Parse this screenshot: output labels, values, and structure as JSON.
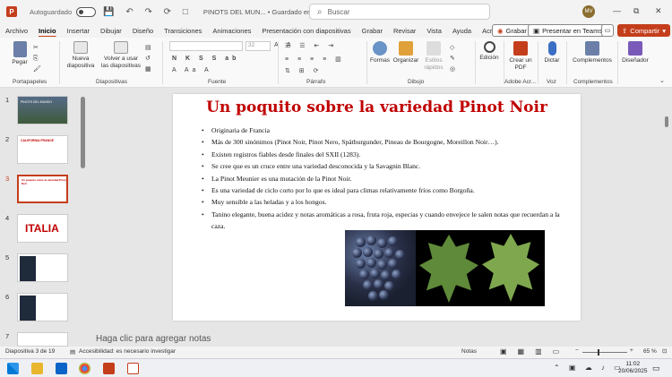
{
  "titlebar": {
    "app_logo": "P",
    "autosave_label": "Autoguardado",
    "quick_access": "💾 ↶ ↷ ⟳ □",
    "document_title": "PINOTS DEL MUN... • Guardado en Este PC ∨",
    "search_placeholder": "Buscar",
    "user_initials": "MV"
  },
  "menu": {
    "tabs": [
      "Archivo",
      "Inicio",
      "Insertar",
      "Dibujar",
      "Diseño",
      "Transiciones",
      "Animaciones",
      "Presentación con diapositivas",
      "Grabar",
      "Revisar",
      "Vista",
      "Ayuda",
      "Acrobat"
    ],
    "active_tab": "Inicio",
    "grabar_btn": "Grabar",
    "present_teams_btn": "Presentar en Teams",
    "share_btn": "Compartir"
  },
  "ribbon": {
    "paste": "Pegar",
    "new_slide": "Nueva diapositiva",
    "reuse_slides": "Volver a usar las diapositivas",
    "font_size": "32",
    "shapes": "Formas",
    "arrange": "Organizar",
    "quick_styles": "Estilos rápidos",
    "editing": "Edición",
    "create_pdf": "Crear un PDF",
    "dictate": "Dictar",
    "addins": "Complementos",
    "designer": "Diseñador",
    "groups": {
      "clipboard": "Portapapeles",
      "slides": "Diapositivas",
      "font": "Fuente",
      "paragraph": "Párrafo",
      "drawing": "Dibujo",
      "adobe": "Adobe Acr...",
      "voice": "Voz",
      "addins": "Complementos"
    }
  },
  "thumbnails": [
    {
      "num": "1",
      "label": "PINOTS DEL MUNDO"
    },
    {
      "num": "2",
      "label": "CALIFORNIA FRANCE"
    },
    {
      "num": "3",
      "label": "Un poquito sobre la variedad Pinot Noir"
    },
    {
      "num": "4",
      "label": "ITALIA"
    },
    {
      "num": "5",
      "label": ""
    },
    {
      "num": "6",
      "label": ""
    },
    {
      "num": "7",
      "label": ""
    }
  ],
  "slide": {
    "title": "Un poquito sobre la variedad Pinot Noir",
    "bullets": [
      "Originaria de Francia",
      "Más de 300 sinónimos (Pinot Noir, Pinot Nero, Spätburgunder, Pineau de Bourgogne, Moreillon Noir…).",
      "Existen registros fiables desde finales del SXII (1283).",
      "Se cree que es un cruce entre una variedad desconocida y la Savagnin Blanc.",
      "La Pinot Meunier es una mutación de la Pinot Noir.",
      "Es una variedad de ciclo corto por lo que es ideal para climas relativamente fríos como Borgoña.",
      "Muy sensible a las heladas y a los hongos.",
      "Tanino elegante, buena acidez y notas aromáticas a rosa, fruta roja, especias y cuando envejece le salen notas que recuerdan a la caza."
    ]
  },
  "notes_placeholder": "Haga clic para agregar notas",
  "statusbar": {
    "slide_counter": "Diapositiva 3 de 19",
    "accessibility": "Accesibilidad: es necesario investigar",
    "notes_btn": "Notas",
    "zoom": "65 %"
  },
  "taskbar": {
    "time": "11:02",
    "date": "20/06/2025"
  },
  "colors": {
    "accent": "#c43e1c",
    "slide_title": "#c00000"
  }
}
